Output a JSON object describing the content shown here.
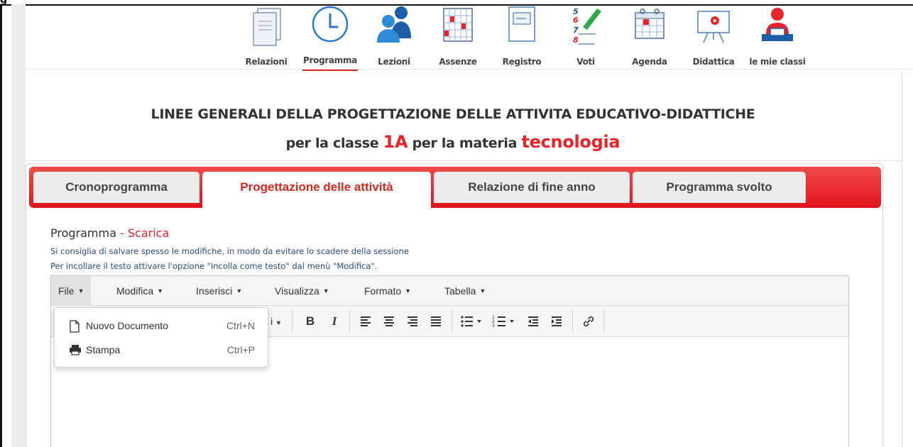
{
  "window": {
    "cut_title": "g"
  },
  "nav": {
    "items": [
      {
        "label": "Relazioni",
        "icon": "reports-icon"
      },
      {
        "label": "Programma",
        "icon": "clock-icon",
        "active": true
      },
      {
        "label": "Lezioni",
        "icon": "students-icon"
      },
      {
        "label": "Assenze",
        "icon": "attendance-grid-icon"
      },
      {
        "label": "Registro",
        "icon": "register-icon"
      },
      {
        "label": "Voti",
        "icon": "grades-icon"
      },
      {
        "label": "Agenda",
        "icon": "calendar-icon"
      },
      {
        "label": "Didattica",
        "icon": "teaching-board-icon"
      },
      {
        "label": "le mie classi",
        "icon": "teacher-icon"
      }
    ]
  },
  "heading": {
    "line1": "LINEE GENERALI DELLA PROGETTAZIONE DELLE ATTIVITA EDUCATIVO-DIDATTICHE",
    "line2_prefix": "per la classe ",
    "classe": "1A",
    "line2_middle": " per la materia ",
    "materia": "tecnologia"
  },
  "tabs": [
    {
      "label": "Cronoprogramma"
    },
    {
      "label": "Progettazione delle attività",
      "active": true
    },
    {
      "label": "Relazione di fine anno"
    },
    {
      "label": "Programma svolto"
    }
  ],
  "section": {
    "title": "Programma",
    "sep": " - ",
    "download_link": "Scarica",
    "note1": "Si consiglia di salvare spesso le modifiche, in modo da evitare lo scadere della sessione",
    "note2": "Per incollare il testo attivare l'opzione \"Incolla come testo\" dal menù \"Modifica\"."
  },
  "editor": {
    "menus": [
      {
        "label": "File",
        "open": true
      },
      {
        "label": "Modifica"
      },
      {
        "label": "Inserisci"
      },
      {
        "label": "Visualizza"
      },
      {
        "label": "Formato"
      },
      {
        "label": "Tabella"
      }
    ],
    "toolbar": {
      "partial_label": "i",
      "bold": "B",
      "italic": "I"
    },
    "file_menu": [
      {
        "label": "Nuovo Documento",
        "shortcut": "Ctrl+N",
        "icon": "new-document-icon"
      },
      {
        "label": "Stampa",
        "shortcut": "Ctrl+P",
        "icon": "printer-icon"
      }
    ]
  },
  "colors": {
    "accent": "#e8232a",
    "tab_active_text": "#d3271e",
    "note_text": "#2a4a86"
  }
}
